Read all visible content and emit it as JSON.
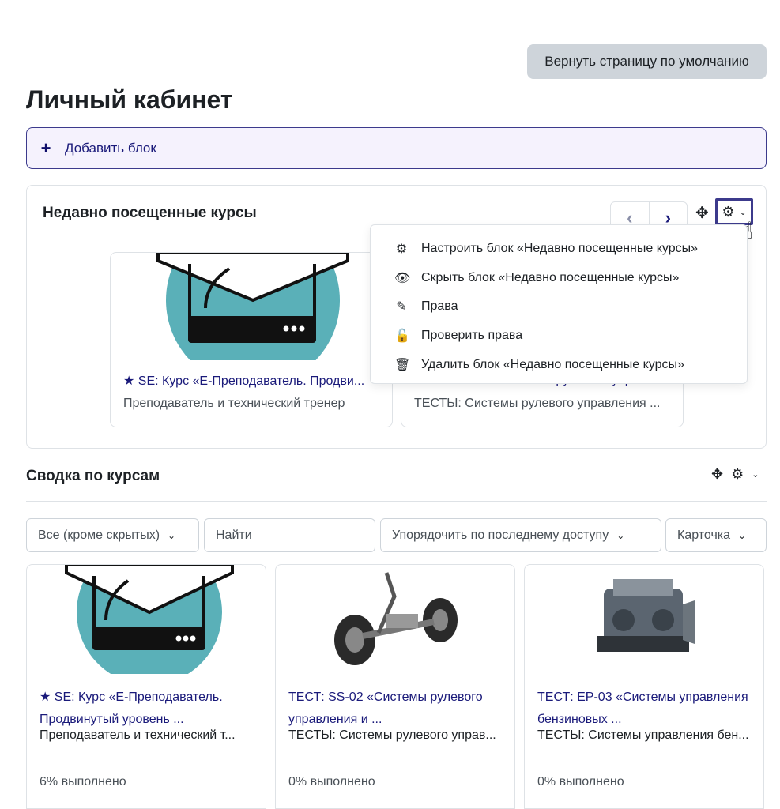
{
  "header": {
    "reset_button": "Вернуть страницу по умолчанию",
    "title": "Личный кабинет"
  },
  "add_block": {
    "icon": "plus-icon",
    "label": "Добавить блок"
  },
  "recent_block": {
    "title": "Недавно посещенные курсы",
    "nav_prev": "‹",
    "nav_next": "›",
    "courses": [
      {
        "name": "SE: Курс «Е-Преподаватель. Продви...",
        "category": "Преподаватель и технический тренер"
      },
      {
        "name": "ТЕСТ: SS-02 «Системы рулевого управл...",
        "category": "ТЕСТЫ: Системы рулевого управления ..."
      }
    ],
    "menu": [
      {
        "icon": "gear-icon",
        "label": "Настроить блок «Недавно посещенные курсы»"
      },
      {
        "icon": "eye-icon",
        "label": "Скрыть блок «Недавно посещенные курсы»"
      },
      {
        "icon": "edit-icon",
        "label": "Права"
      },
      {
        "icon": "unlock-icon",
        "label": "Проверить права"
      },
      {
        "icon": "trash-icon",
        "label": "Удалить блок «Недавно посещенные курсы»"
      }
    ]
  },
  "summary": {
    "title": "Сводка по курсам",
    "filters": {
      "grouping": "Все (кроме скрытых)",
      "search_placeholder": "Найти",
      "sort": "Упорядочить по последнему доступу",
      "view": "Карточка"
    },
    "courses": [
      {
        "name": "SE: Курс «Е-Преподаватель. Продвинутый уровень ...",
        "category": "Преподаватель и технический т...",
        "progress": "6% выполнено",
        "starred": true
      },
      {
        "name": "ТЕСТ: SS-02 «Системы рулевого управления и ...",
        "category": "ТЕСТЫ: Системы рулевого управ...",
        "progress": "0% выполнено",
        "starred": false
      },
      {
        "name": "ТЕСТ: EP-03 «Системы управления бензиновых ...",
        "category": "ТЕСТЫ: Системы управления бен...",
        "progress": "0% выполнено",
        "starred": false
      }
    ]
  },
  "colors": {
    "accent": "#1a1a7a",
    "focus": "#3c3a8c",
    "teal": "#5ab0b8"
  }
}
